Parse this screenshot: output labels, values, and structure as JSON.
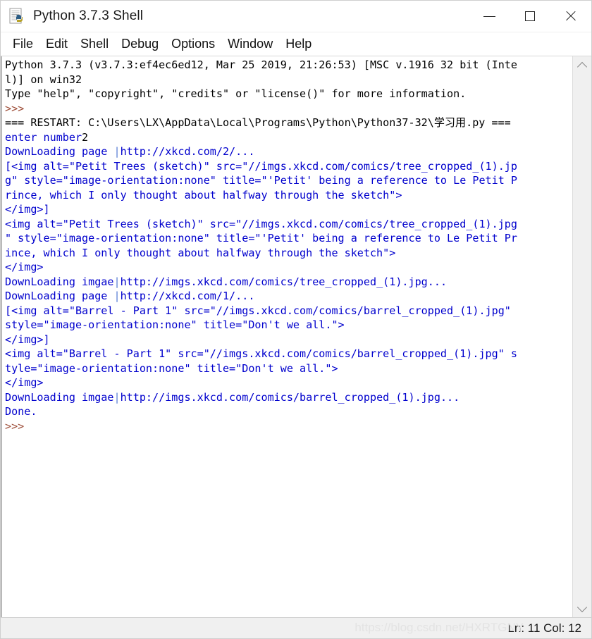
{
  "window": {
    "title": "Python 3.7.3 Shell",
    "icon": "python-file-icon",
    "controls": {
      "minimize": "minimize-icon",
      "maximize": "maximize-icon",
      "close": "close-icon"
    }
  },
  "menubar": {
    "items": [
      {
        "label": "File"
      },
      {
        "label": "Edit"
      },
      {
        "label": "Shell"
      },
      {
        "label": "Debug"
      },
      {
        "label": "Options"
      },
      {
        "label": "Window"
      },
      {
        "label": "Help"
      }
    ]
  },
  "console": {
    "lines": [
      {
        "segs": [
          {
            "t": "Python 3.7.3 (v3.7.3:ef4ec6ed12, Mar 25 2019, 21:26:53) [MSC v.1916 32 bit (Inte",
            "c": "c-black"
          }
        ]
      },
      {
        "segs": [
          {
            "t": "l)] on win32",
            "c": "c-black"
          }
        ]
      },
      {
        "segs": [
          {
            "t": "Type \"help\", \"copyright\", \"credits\" or \"license()\" for more information.",
            "c": "c-black"
          }
        ]
      },
      {
        "segs": [
          {
            "t": ">>> ",
            "c": "c-prompt"
          }
        ]
      },
      {
        "segs": [
          {
            "t": "=== RESTART: C:\\Users\\LX\\AppData\\Local\\Programs\\Python\\Python37-32\\学习用.py ===",
            "c": "c-rst"
          }
        ]
      },
      {
        "segs": [
          {
            "t": "enter number",
            "c": "c-out"
          },
          {
            "t": "2",
            "c": "c-black"
          }
        ]
      },
      {
        "segs": [
          {
            "t": "DownLoading page ",
            "c": "c-out"
          },
          {
            "t": "|",
            "c": "c-bar"
          },
          {
            "t": "http://xkcd.com/2/...",
            "c": "c-out"
          }
        ]
      },
      {
        "segs": [
          {
            "t": "[<img alt=\"Petit Trees (sketch)\" src=\"//imgs.xkcd.com/comics/tree_cropped_(1).jp",
            "c": "c-out"
          }
        ]
      },
      {
        "segs": [
          {
            "t": "g\" style=\"image-orientation:none\" title=\"'Petit' being a reference to Le Petit P",
            "c": "c-out"
          }
        ]
      },
      {
        "segs": [
          {
            "t": "rince, which I only thought about halfway through the sketch\">",
            "c": "c-out"
          }
        ]
      },
      {
        "segs": [
          {
            "t": "</img>]",
            "c": "c-out"
          }
        ]
      },
      {
        "segs": [
          {
            "t": "<img alt=\"Petit Trees (sketch)\" src=\"//imgs.xkcd.com/comics/tree_cropped_(1).jpg",
            "c": "c-out"
          }
        ]
      },
      {
        "segs": [
          {
            "t": "\" style=\"image-orientation:none\" title=\"'Petit' being a reference to Le Petit Pr",
            "c": "c-out"
          }
        ]
      },
      {
        "segs": [
          {
            "t": "ince, which I only thought about halfway through the sketch\">",
            "c": "c-out"
          }
        ]
      },
      {
        "segs": [
          {
            "t": "</img>",
            "c": "c-out"
          }
        ]
      },
      {
        "segs": [
          {
            "t": "DownLoading imgae",
            "c": "c-out"
          },
          {
            "t": "|",
            "c": "c-bar"
          },
          {
            "t": "http://imgs.xkcd.com/comics/tree_cropped_(1).jpg...",
            "c": "c-out"
          }
        ]
      },
      {
        "segs": [
          {
            "t": "DownLoading page ",
            "c": "c-out"
          },
          {
            "t": "|",
            "c": "c-bar"
          },
          {
            "t": "http://xkcd.com/1/...",
            "c": "c-out"
          }
        ]
      },
      {
        "segs": [
          {
            "t": "[<img alt=\"Barrel - Part 1\" src=\"//imgs.xkcd.com/comics/barrel_cropped_(1).jpg\"",
            "c": "c-out"
          }
        ]
      },
      {
        "segs": [
          {
            "t": "style=\"image-orientation:none\" title=\"Don't we all.\">",
            "c": "c-out"
          }
        ]
      },
      {
        "segs": [
          {
            "t": "</img>]",
            "c": "c-out"
          }
        ]
      },
      {
        "segs": [
          {
            "t": "<img alt=\"Barrel - Part 1\" src=\"//imgs.xkcd.com/comics/barrel_cropped_(1).jpg\" s",
            "c": "c-out"
          }
        ]
      },
      {
        "segs": [
          {
            "t": "tyle=\"image-orientation:none\" title=\"Don't we all.\">",
            "c": "c-out"
          }
        ]
      },
      {
        "segs": [
          {
            "t": "</img>",
            "c": "c-out"
          }
        ]
      },
      {
        "segs": [
          {
            "t": "DownLoading imgae",
            "c": "c-out"
          },
          {
            "t": "|",
            "c": "c-bar"
          },
          {
            "t": "http://imgs.xkcd.com/comics/barrel_cropped_(1).jpg...",
            "c": "c-out"
          }
        ]
      },
      {
        "segs": [
          {
            "t": "Done.",
            "c": "c-out"
          }
        ]
      },
      {
        "segs": [
          {
            "t": ">>> ",
            "c": "c-prompt"
          }
        ]
      }
    ]
  },
  "scrollbar": {
    "up_arrow": "chevron-up-icon",
    "down_arrow": "chevron-down-icon"
  },
  "statusbar": {
    "position": "Ln: 11  Col: 12",
    "watermark": "https://blog.csdn.net/HXRTGNY"
  },
  "colors": {
    "stdout_blue": "#0000cd",
    "prompt_brown": "#9e4f3a",
    "text_black": "#000000",
    "chrome_gray": "#f0f0f0"
  }
}
